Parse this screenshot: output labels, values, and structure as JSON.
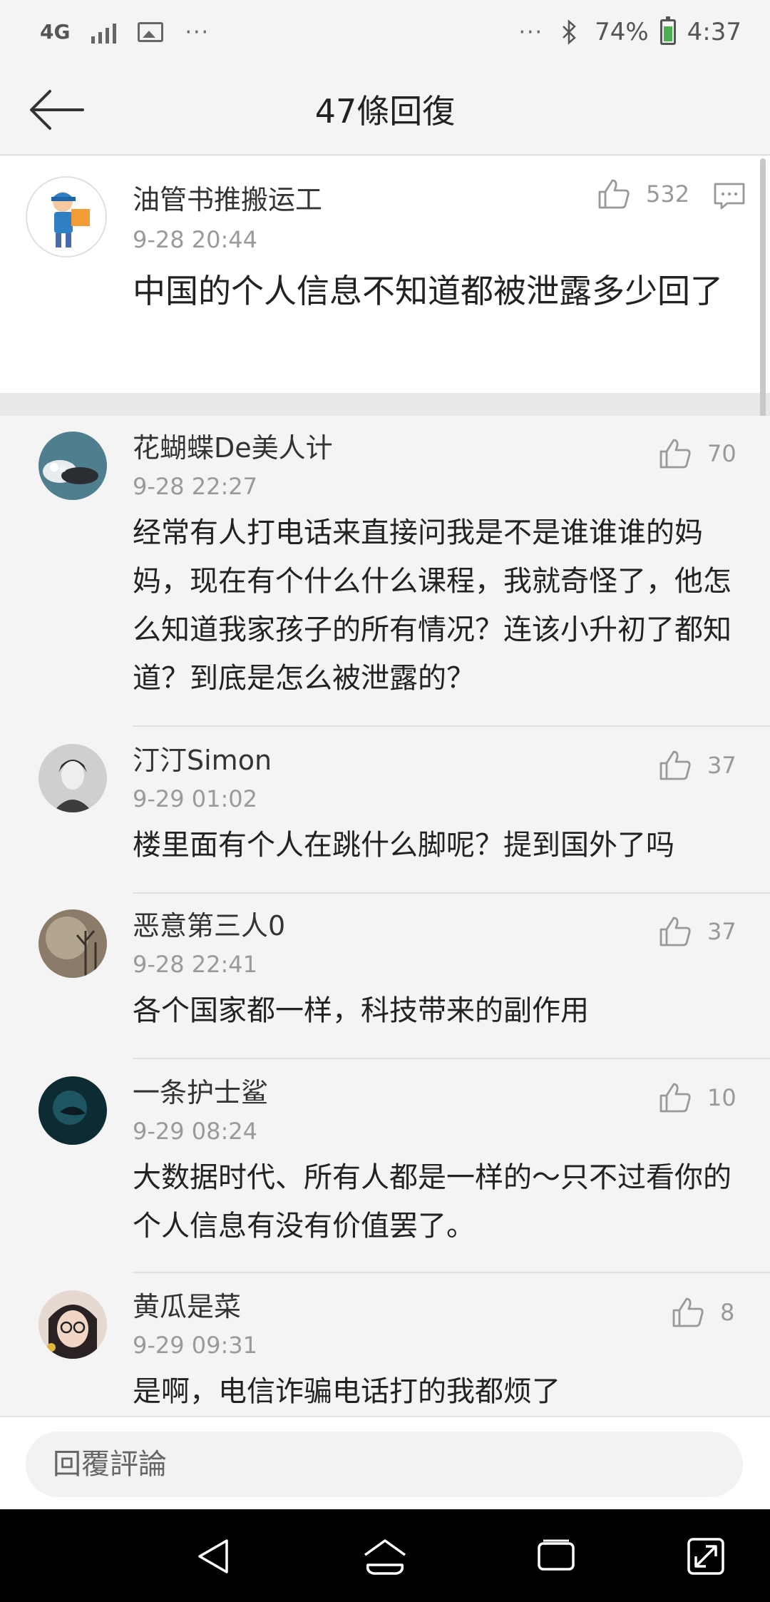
{
  "status_bar": {
    "network": "4G",
    "more_left": "···",
    "more_right": "···",
    "battery": "74%",
    "time": "4:37"
  },
  "header": {
    "title": "47條回復"
  },
  "top_comment": {
    "author": "油管书推搬运工",
    "time": "9-28 20:44",
    "likes": "532",
    "text": "中国的个人信息不知道都被泄露多少回了"
  },
  "replies": [
    {
      "author": "花蝴蝶De美人计",
      "time": "9-28 22:27",
      "likes": "70",
      "text": "经常有人打电话来直接问我是不是谁谁谁的妈妈，现在有个什么什么课程，我就奇怪了，他怎么知道我家孩子的所有情况？连该小升初了都知道？到底是怎么被泄露的？"
    },
    {
      "author": "汀汀Simon",
      "time": "9-29 01:02",
      "likes": "37",
      "text": "楼里面有个人在跳什么脚呢？提到国外了吗"
    },
    {
      "author": "恶意第三人0",
      "time": "9-28 22:41",
      "likes": "37",
      "text": "各个国家都一样，科技带来的副作用"
    },
    {
      "author": "一条护士鲨",
      "time": "9-29 08:24",
      "likes": "10",
      "text": "大数据时代、所有人都是一样的～只不过看你的个人信息有没有价值罢了。"
    },
    {
      "author": "黄瓜是菜",
      "time": "9-29 09:31",
      "likes": "8",
      "text": "是啊，电信诈骗电话打的我都烦了"
    }
  ],
  "input": {
    "placeholder": "回覆評論"
  },
  "icons": {
    "like": "thumbs-up-icon",
    "reply": "comment-icon",
    "back": "arrow-left-icon"
  },
  "colors": {
    "background": "#f4f4f4",
    "card": "#ffffff",
    "muted_text": "#9a9a9a",
    "battery_green": "#4caf50"
  }
}
